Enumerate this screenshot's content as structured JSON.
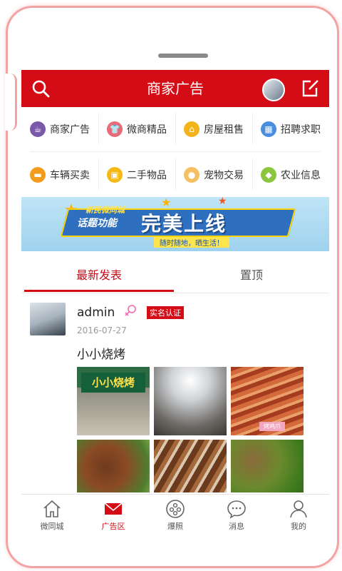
{
  "header": {
    "title": "商家广告"
  },
  "categories": [
    {
      "label": "商家广告",
      "color": "#7a5aa8",
      "icon": "shop-icon"
    },
    {
      "label": "微商精品",
      "color": "#e86b7a",
      "icon": "shirt-icon"
    },
    {
      "label": "房屋租售",
      "color": "#f3b41b",
      "icon": "house-icon"
    },
    {
      "label": "招聘求职",
      "color": "#4a8ee0",
      "icon": "grid-icon"
    },
    {
      "label": "车辆买卖",
      "color": "#f39c1b",
      "icon": "car-icon"
    },
    {
      "label": "二手物品",
      "color": "#f5b915",
      "icon": "bag-icon"
    },
    {
      "label": "宠物交易",
      "color": "#f5c064",
      "icon": "duck-icon"
    },
    {
      "label": "农业信息",
      "color": "#8cc63f",
      "icon": "tractor-icon"
    }
  ],
  "banner": {
    "line1": "新民微同城",
    "line2": "话题功能",
    "headline": "完美上线",
    "subline": "随时随地，晒生活！"
  },
  "tabs": [
    {
      "label": "最新发表",
      "active": true
    },
    {
      "label": "置顶",
      "active": false
    }
  ],
  "post": {
    "username": "admin",
    "badge": "实名认证",
    "date": "2016-07-27",
    "text": "小小烧烤",
    "photo1_sign": "小小烧烤",
    "photo3_tag": "烤鸡爪"
  },
  "bottom_nav": [
    {
      "label": "微同城",
      "active": false,
      "icon": "home-icon"
    },
    {
      "label": "广告区",
      "active": true,
      "icon": "mail-icon"
    },
    {
      "label": "爆照",
      "active": false,
      "icon": "camera-icon"
    },
    {
      "label": "消息",
      "active": false,
      "icon": "chat-icon"
    },
    {
      "label": "我的",
      "active": false,
      "icon": "user-icon"
    }
  ],
  "colors": {
    "brand": "#d40c16",
    "frame": "#f2a3a3"
  }
}
